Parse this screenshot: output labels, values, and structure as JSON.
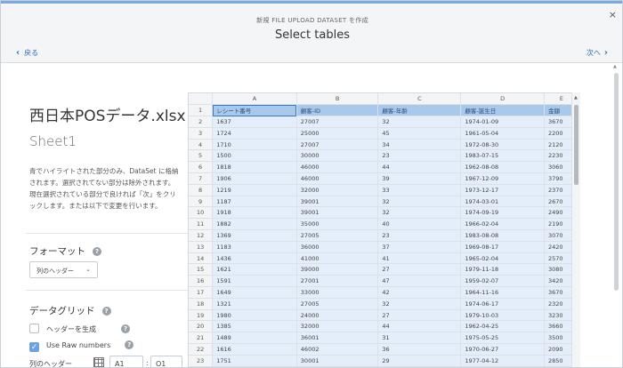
{
  "header": {
    "subtitle": "新規 FILE UPLOAD DATASET を作成",
    "title": "Select tables",
    "back_label": "戻る",
    "next_label": "次へ",
    "close": "×"
  },
  "left": {
    "filename": "西日本POSデータ.xlsx",
    "sheet": "Sheet1",
    "description": "青でハイライトされた部分のみ、DataSet に格納されます。選択されてない部分は除外されます。現在選択されている部分で良ければ「次」をクリックします。または以下で変更を行います。",
    "format_heading": "フォーマット",
    "format_value": "列のヘッダー",
    "grid_heading": "データグリッド",
    "header_generate_label": "ヘッダーを生成",
    "header_generate_checked": false,
    "raw_numbers_label": "Use Raw numbers",
    "raw_numbers_checked": true,
    "header_range_label": "列のヘッダー",
    "range_start": "A1",
    "range_sep": ":",
    "range_end": "O1"
  },
  "grid": {
    "columns": [
      "A",
      "B",
      "C",
      "D",
      "E"
    ],
    "rows": [
      {
        "n": "1",
        "cells": [
          "レシート番号",
          "顧客-ID",
          "顧客-年齢",
          "顧客-誕生日",
          "金額"
        ]
      },
      {
        "n": "2",
        "cells": [
          "1637",
          "27007",
          "32",
          "1974-01-09",
          "3670"
        ]
      },
      {
        "n": "3",
        "cells": [
          "1724",
          "25000",
          "45",
          "1961-05-04",
          "2200"
        ]
      },
      {
        "n": "4",
        "cells": [
          "1710",
          "27007",
          "34",
          "1972-08-30",
          "2120"
        ]
      },
      {
        "n": "5",
        "cells": [
          "1500",
          "30000",
          "23",
          "1983-07-15",
          "2230"
        ]
      },
      {
        "n": "6",
        "cells": [
          "1818",
          "46000",
          "44",
          "1962-08-08",
          "3060"
        ]
      },
      {
        "n": "7",
        "cells": [
          "1906",
          "46000",
          "39",
          "1967-12-09",
          "3790"
        ]
      },
      {
        "n": "8",
        "cells": [
          "1219",
          "32000",
          "33",
          "1973-12-17",
          "2370"
        ]
      },
      {
        "n": "9",
        "cells": [
          "1187",
          "39001",
          "32",
          "1974-03-01",
          "2670"
        ]
      },
      {
        "n": "10",
        "cells": [
          "1918",
          "39001",
          "32",
          "1974-09-19",
          "2490"
        ]
      },
      {
        "n": "11",
        "cells": [
          "1882",
          "35000",
          "40",
          "1966-02-04",
          "2190"
        ]
      },
      {
        "n": "12",
        "cells": [
          "1369",
          "27005",
          "23",
          "1983-08-08",
          "3070"
        ]
      },
      {
        "n": "13",
        "cells": [
          "1183",
          "36000",
          "37",
          "1969-08-17",
          "2420"
        ]
      },
      {
        "n": "14",
        "cells": [
          "1436",
          "41000",
          "41",
          "1965-02-04",
          "2570"
        ]
      },
      {
        "n": "15",
        "cells": [
          "1621",
          "39000",
          "27",
          "1979-11-18",
          "3080"
        ]
      },
      {
        "n": "16",
        "cells": [
          "1591",
          "27001",
          "47",
          "1959-02-07",
          "3420"
        ]
      },
      {
        "n": "17",
        "cells": [
          "1649",
          "33000",
          "42",
          "1964-11-16",
          "3670"
        ]
      },
      {
        "n": "18",
        "cells": [
          "1321",
          "27005",
          "32",
          "1974-06-17",
          "2320"
        ]
      },
      {
        "n": "19",
        "cells": [
          "1980",
          "24000",
          "27",
          "1979-10-03",
          "3230"
        ]
      },
      {
        "n": "20",
        "cells": [
          "1385",
          "32000",
          "44",
          "1962-04-25",
          "3660"
        ]
      },
      {
        "n": "21",
        "cells": [
          "1489",
          "36001",
          "31",
          "1975-05-25",
          "3500"
        ]
      },
      {
        "n": "22",
        "cells": [
          "1616",
          "46002",
          "36",
          "1970-06-27",
          "2090"
        ]
      },
      {
        "n": "23",
        "cells": [
          "1751",
          "30001",
          "29",
          "1977-04-12",
          "2850"
        ]
      }
    ]
  },
  "colors": {
    "accent": "#2f6fb3",
    "selected_cell": "#e3eefa",
    "header_row": "#a8c8ec"
  }
}
